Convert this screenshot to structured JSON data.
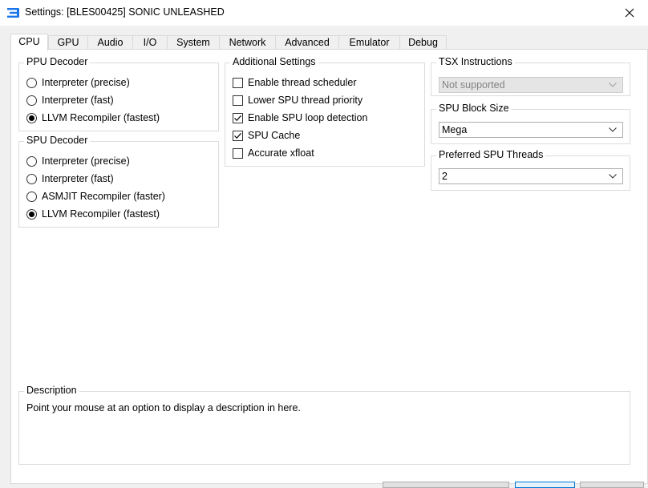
{
  "window": {
    "title": "Settings: [BLES00425] SONIC UNLEASHED",
    "close_label": "✕"
  },
  "tabs": [
    "CPU",
    "GPU",
    "Audio",
    "I/O",
    "System",
    "Network",
    "Advanced",
    "Emulator",
    "Debug"
  ],
  "active_tab": "CPU",
  "ppu_decoder": {
    "title": "PPU Decoder",
    "options": [
      "Interpreter (precise)",
      "Interpreter (fast)",
      "LLVM Recompiler (fastest)"
    ],
    "selected": "LLVM Recompiler (fastest)"
  },
  "spu_decoder": {
    "title": "SPU Decoder",
    "options": [
      "Interpreter (precise)",
      "Interpreter (fast)",
      "ASMJIT Recompiler (faster)",
      "LLVM Recompiler (fastest)"
    ],
    "selected": "LLVM Recompiler (fastest)"
  },
  "additional_settings": {
    "title": "Additional Settings",
    "items": [
      {
        "label": "Enable thread scheduler",
        "checked": false
      },
      {
        "label": "Lower SPU thread priority",
        "checked": false
      },
      {
        "label": "Enable SPU loop detection",
        "checked": true
      },
      {
        "label": "SPU Cache",
        "checked": true
      },
      {
        "label": "Accurate xfloat",
        "checked": false
      }
    ]
  },
  "tsx_instructions": {
    "title": "TSX Instructions",
    "value": "Not supported",
    "disabled": true
  },
  "spu_block_size": {
    "title": "SPU Block Size",
    "value": "Mega"
  },
  "preferred_spu_threads": {
    "title": "Preferred SPU Threads",
    "value": "2"
  },
  "description": {
    "title": "Description",
    "text": "Point your mouse at an option to display a description in here."
  },
  "colors": {
    "accent": "#0078d7",
    "app_icon": "#1a73e8",
    "window_bg": "#f0f0f0",
    "panel_bg": "#ffffff",
    "disabled_text": "#838383"
  },
  "icons": {
    "app": "app-logo-icon",
    "close": "close-icon",
    "dropdown": "chevron-down-icon",
    "checkmark": "checkmark-icon"
  }
}
